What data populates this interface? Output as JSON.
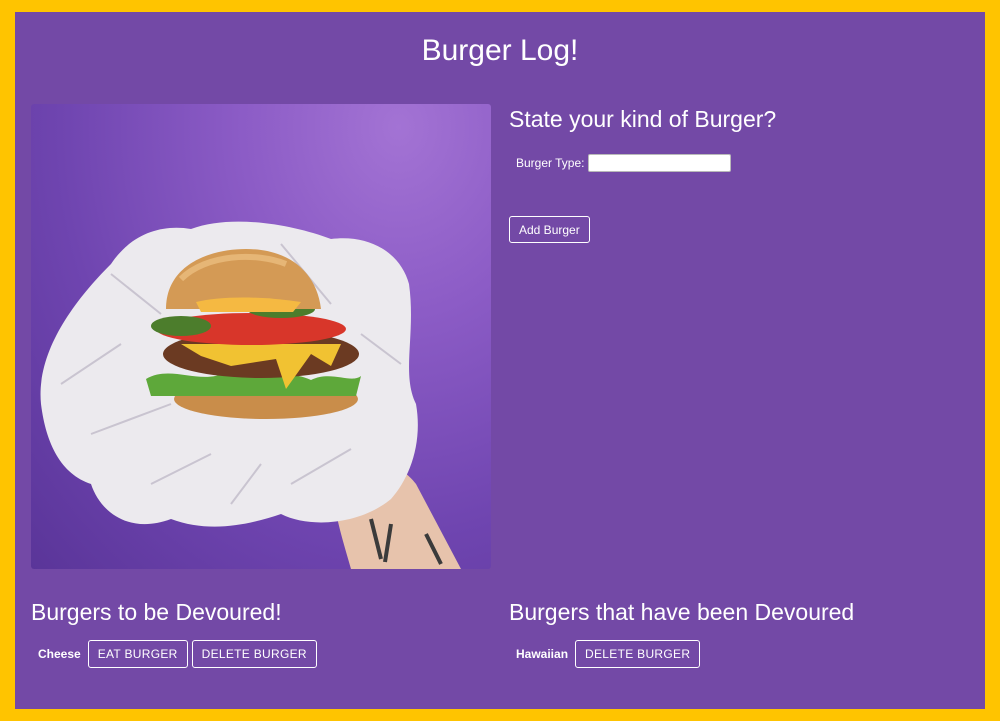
{
  "page": {
    "title": "Burger Log!",
    "colors": {
      "frame_border": "#ffc400",
      "background": "#7349a6",
      "text": "#ffffff"
    }
  },
  "hero_image": {
    "subject": "burger-in-hand-photo"
  },
  "form": {
    "heading": "State your kind of Burger?",
    "type_label": "Burger Type:",
    "type_value": "",
    "submit_label": "Add Burger"
  },
  "to_devour": {
    "heading": "Burgers to be Devoured!",
    "items": [
      {
        "name": "Cheese",
        "eat_label": "EAT BURGER",
        "delete_label": "DELETE BURGER"
      }
    ]
  },
  "devoured": {
    "heading": "Burgers that have been Devoured",
    "items": [
      {
        "name": "Hawaiian",
        "delete_label": "DELETE BURGER"
      }
    ]
  }
}
